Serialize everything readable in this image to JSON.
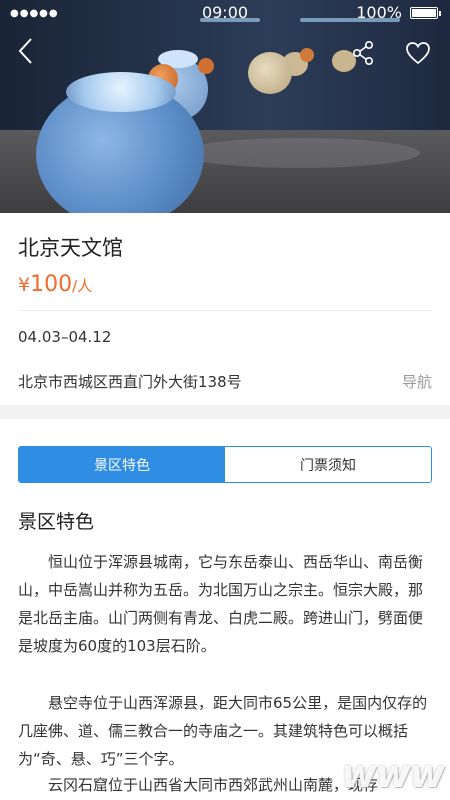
{
  "status_bar": {
    "signal": "●●●●●",
    "time": "09:00",
    "battery": "100%"
  },
  "hero": {
    "back_icon": "chevron-left-icon",
    "share_icon": "share-icon",
    "favorite_icon": "heart-icon"
  },
  "venue": {
    "title": "北京天文馆",
    "price_currency": "¥",
    "price_value": "100",
    "price_unit": "/人",
    "date_range": "04.03–04.12",
    "address": "北京市西城区西直门外大街138号",
    "nav_label": "导航"
  },
  "tabs": [
    {
      "label": "景区特色",
      "active": true
    },
    {
      "label": "门票须知",
      "active": false
    }
  ],
  "content": {
    "section_title": "景区特色",
    "paragraphs": [
      "恒山位于浑源县城南，它与东岳泰山、西岳华山、南岳衡山，中岳嵩山并称为五岳。为北国万山之宗主。恒宗大殿，那是北岳主庙。山门两侧有青龙、白虎二殿。跨进山门，劈面便是坡度为60度的103层石阶。",
      "悬空寺位于山西浑源县，距大同市65公里，是国内仅存的几座佛、道、儒三教合一的寺庙之一。其建筑特色可以概括为“奇、悬、巧”三个字。",
      "云冈石窟位于山西省大同市西郊武州山南麓，现存"
    ]
  },
  "watermark": "www",
  "colors": {
    "accent": "#2f8de4",
    "price": "#f26a2c",
    "muted": "#9a9a9a"
  }
}
